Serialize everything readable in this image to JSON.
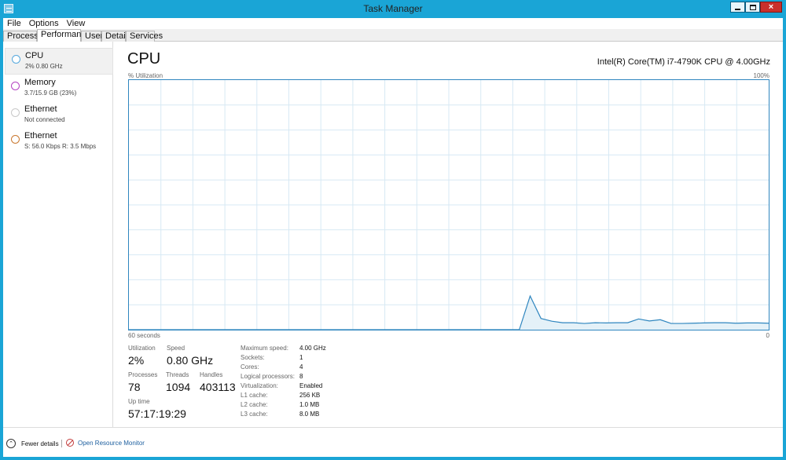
{
  "window": {
    "title": "Task Manager"
  },
  "menus": [
    "File",
    "Options",
    "View"
  ],
  "tabs": [
    {
      "label": "Processes",
      "active": false
    },
    {
      "label": "Performance",
      "active": true
    },
    {
      "label": "Users",
      "active": false
    },
    {
      "label": "Details",
      "active": false
    },
    {
      "label": "Services",
      "active": false
    }
  ],
  "sidebar": {
    "items": [
      {
        "name": "CPU",
        "detail": "2% 0.80 GHz",
        "color": "#55a8dd",
        "selected": true
      },
      {
        "name": "Memory",
        "detail": "3.7/15.9 GB (23%)",
        "color": "#b443c2",
        "selected": false
      },
      {
        "name": "Ethernet",
        "detail": "Not connected",
        "color": "#c9c9c9",
        "selected": false
      },
      {
        "name": "Ethernet",
        "detail": "S: 56.0 Kbps  R: 3.5 Mbps",
        "color": "#c9782f",
        "selected": false
      }
    ]
  },
  "main": {
    "title": "CPU",
    "processor": "Intel(R) Core(TM) i7-4790K CPU @ 4.00GHz",
    "graph": {
      "top_left": "% Utilization",
      "top_right": "100%",
      "bottom_left": "60 seconds",
      "bottom_right": "0",
      "colors": {
        "line": "#2f86bf",
        "grid": "#d7e9f4",
        "fill": "#e4f1f8"
      },
      "utilization_points": [
        0,
        0,
        0,
        0,
        0,
        0,
        0,
        0,
        0,
        0,
        0,
        0,
        0,
        0,
        0,
        0,
        0,
        0,
        0,
        0,
        0,
        0,
        0,
        0,
        0,
        0,
        0,
        0,
        0,
        0,
        0,
        0,
        0,
        0,
        0,
        0,
        0,
        13.5,
        4.5,
        3.4,
        2.8,
        2.8,
        2.5,
        2.8,
        2.7,
        2.8,
        2.8,
        4.3,
        3.5,
        4.0,
        2.5,
        2.5,
        2.6,
        2.7,
        2.8,
        2.8,
        2.6,
        2.7,
        2.7,
        2.6
      ]
    },
    "stats": {
      "utilization_label": "Utilization",
      "utilization_value": "2%",
      "speed_label": "Speed",
      "speed_value": "0.80 GHz",
      "processes_label": "Processes",
      "processes_value": "78",
      "threads_label": "Threads",
      "threads_value": "1094",
      "handles_label": "Handles",
      "handles_value": "403113",
      "uptime_label": "Up time",
      "uptime_value": "57:17:19:29"
    },
    "info": [
      {
        "label": "Maximum speed:",
        "value": "4.00 GHz"
      },
      {
        "label": "Sockets:",
        "value": "1"
      },
      {
        "label": "Cores:",
        "value": "4"
      },
      {
        "label": "Logical processors:",
        "value": "8"
      },
      {
        "label": "Virtualization:",
        "value": "Enabled"
      },
      {
        "label": "L1 cache:",
        "value": "256 KB"
      },
      {
        "label": "L2 cache:",
        "value": "1.0 MB"
      },
      {
        "label": "L3 cache:",
        "value": "8.0 MB"
      }
    ]
  },
  "footer": {
    "fewer_details": "Fewer details",
    "open_resource_monitor": "Open Resource Monitor"
  }
}
